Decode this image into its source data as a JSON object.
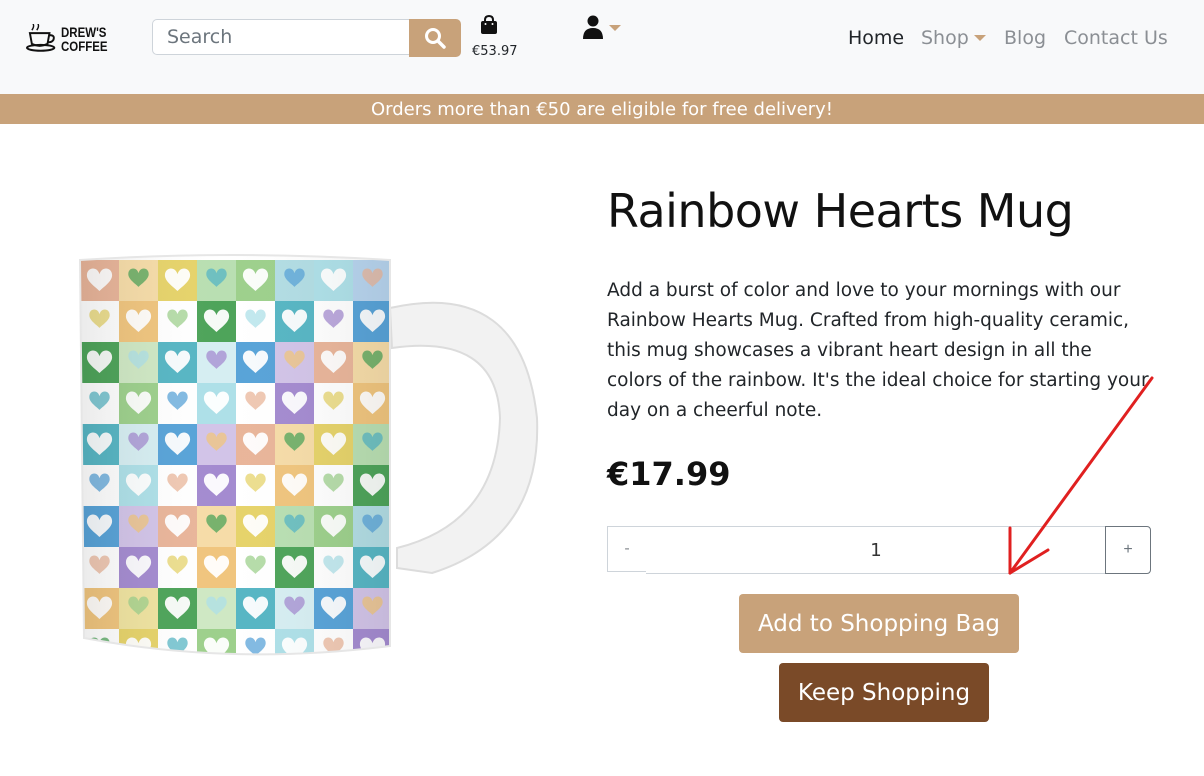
{
  "header": {
    "logo_lines": [
      "DREW'S",
      "COFFEE"
    ],
    "search": {
      "placeholder": "Search",
      "value": ""
    },
    "bag_total": "€53.97",
    "nav": {
      "home": "Home",
      "shop": "Shop",
      "blog": "Blog",
      "contact": "Contact Us"
    }
  },
  "banner": {
    "text": "Orders more than €50 are eligible for free delivery!"
  },
  "product": {
    "name": "Rainbow Hearts Mug",
    "description": "Add a burst of color and love to your mornings with our Rainbow Hearts Mug. Crafted from high-quality ceramic, this mug showcases a vibrant heart design in all the colors of the rainbow. It's the ideal choice for starting your day on a cheerful note.",
    "price": "€17.99",
    "quantity": {
      "minus": "-",
      "value": "1",
      "plus": "+"
    },
    "add_button": "Add to Shopping Bag",
    "keep_button": "Keep Shopping"
  },
  "colors": {
    "accent": "#c8a27a",
    "dark_brown": "#7a4a28",
    "annotation_arrow": "#e02020"
  },
  "icons": {
    "search": "search-icon",
    "bag": "shopping-bag-icon",
    "user": "user-icon",
    "caret": "caret-down-icon"
  }
}
